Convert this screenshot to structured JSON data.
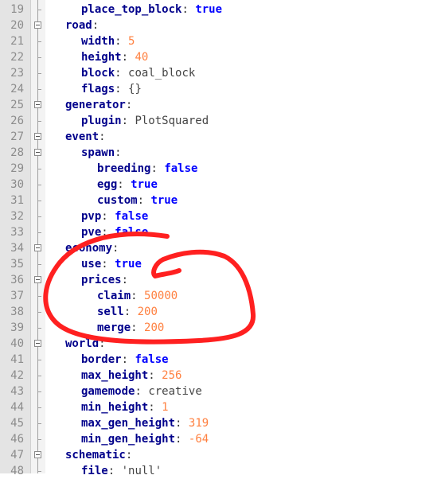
{
  "editor": {
    "lines": [
      {
        "num": "19",
        "indent": 2,
        "key": "place_top_block",
        "value": "true",
        "vtype": "bool",
        "fold": false
      },
      {
        "num": "20",
        "indent": 1,
        "key": "road",
        "value": "",
        "vtype": "none",
        "fold": true
      },
      {
        "num": "21",
        "indent": 2,
        "key": "width",
        "value": "5",
        "vtype": "num",
        "fold": false
      },
      {
        "num": "22",
        "indent": 2,
        "key": "height",
        "value": "40",
        "vtype": "num",
        "fold": false
      },
      {
        "num": "23",
        "indent": 2,
        "key": "block",
        "value": "coal_block",
        "vtype": "str",
        "fold": false
      },
      {
        "num": "24",
        "indent": 2,
        "key": "flags",
        "value": "{}",
        "vtype": "str",
        "fold": false
      },
      {
        "num": "25",
        "indent": 1,
        "key": "generator",
        "value": "",
        "vtype": "none",
        "fold": true
      },
      {
        "num": "26",
        "indent": 2,
        "key": "plugin",
        "value": "PlotSquared",
        "vtype": "str",
        "fold": false
      },
      {
        "num": "27",
        "indent": 1,
        "key": "event",
        "value": "",
        "vtype": "none",
        "fold": true
      },
      {
        "num": "28",
        "indent": 2,
        "key": "spawn",
        "value": "",
        "vtype": "none",
        "fold": true
      },
      {
        "num": "29",
        "indent": 3,
        "key": "breeding",
        "value": "false",
        "vtype": "bool",
        "fold": false
      },
      {
        "num": "30",
        "indent": 3,
        "key": "egg",
        "value": "true",
        "vtype": "bool",
        "fold": false
      },
      {
        "num": "31",
        "indent": 3,
        "key": "custom",
        "value": "true",
        "vtype": "bool",
        "fold": false
      },
      {
        "num": "32",
        "indent": 2,
        "key": "pvp",
        "value": "false",
        "vtype": "bool",
        "fold": false
      },
      {
        "num": "33",
        "indent": 2,
        "key": "pve",
        "value": "false",
        "vtype": "bool",
        "fold": false
      },
      {
        "num": "34",
        "indent": 1,
        "key": "economy",
        "value": "",
        "vtype": "none",
        "fold": true
      },
      {
        "num": "35",
        "indent": 2,
        "key": "use",
        "value": "true",
        "vtype": "bool",
        "fold": false
      },
      {
        "num": "36",
        "indent": 2,
        "key": "prices",
        "value": "",
        "vtype": "none",
        "fold": true
      },
      {
        "num": "37",
        "indent": 3,
        "key": "claim",
        "value": "50000",
        "vtype": "num",
        "fold": false
      },
      {
        "num": "38",
        "indent": 3,
        "key": "sell",
        "value": "200",
        "vtype": "num",
        "fold": false
      },
      {
        "num": "39",
        "indent": 3,
        "key": "merge",
        "value": "200",
        "vtype": "num",
        "fold": false
      },
      {
        "num": "40",
        "indent": 1,
        "key": "world",
        "value": "",
        "vtype": "none",
        "fold": true
      },
      {
        "num": "41",
        "indent": 2,
        "key": "border",
        "value": "false",
        "vtype": "bool",
        "fold": false
      },
      {
        "num": "42",
        "indent": 2,
        "key": "max_height",
        "value": "256",
        "vtype": "num",
        "fold": false
      },
      {
        "num": "43",
        "indent": 2,
        "key": "gamemode",
        "value": "creative",
        "vtype": "str",
        "fold": false
      },
      {
        "num": "44",
        "indent": 2,
        "key": "min_height",
        "value": "1",
        "vtype": "num",
        "fold": false
      },
      {
        "num": "45",
        "indent": 2,
        "key": "max_gen_height",
        "value": "319",
        "vtype": "num",
        "fold": false
      },
      {
        "num": "46",
        "indent": 2,
        "key": "min_gen_height",
        "value": "-64",
        "vtype": "num",
        "fold": false
      },
      {
        "num": "47",
        "indent": 1,
        "key": "schematic",
        "value": "",
        "vtype": "none",
        "fold": true
      },
      {
        "num": "48",
        "indent": 2,
        "key": "file",
        "value": "'null'",
        "vtype": "str",
        "fold": false
      }
    ]
  },
  "colors": {
    "keyword": "#00008b",
    "boolean": "#0000ff",
    "number": "#ff8040",
    "annotation": "#ff2020"
  }
}
